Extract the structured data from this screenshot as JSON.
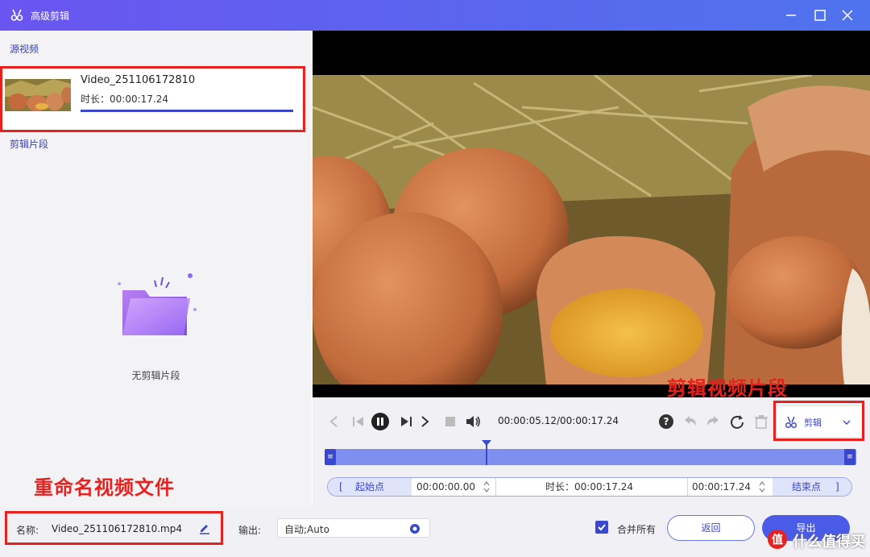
{
  "window": {
    "title": "高级剪辑",
    "accent_color": "#5a5ff0"
  },
  "left_panel": {
    "source_label": "源视频",
    "source_item": {
      "name": "Video_251106172810",
      "duration": "时长：00:00:17.24"
    },
    "clips_label": "剪辑片段",
    "empty_text": "无剪辑片段"
  },
  "controls": {
    "time": "00:00:05.12/00:00:17.24",
    "clip_button_label": "剪辑"
  },
  "timeline": {
    "start_label": "起始点",
    "start_time": "00:00:00.00",
    "duration": "时长：00:00:17.24",
    "end_time": "00:00:17.24",
    "end_label": "结束点",
    "playhead_fraction": 0.297
  },
  "bottom": {
    "name_label": "名称:",
    "file_name": "Video_251106172810.mp4",
    "output_label": "输出:",
    "output_value": "自动;Auto",
    "merge_label": "合并所有",
    "merge_checked": true,
    "back_label": "返回",
    "export_label": "导出"
  },
  "annotations": {
    "clip_note": "剪辑视频片段",
    "rename_note": "重命名视频文件",
    "color": "#e8211e"
  },
  "watermark": {
    "text": "什么值得买"
  }
}
